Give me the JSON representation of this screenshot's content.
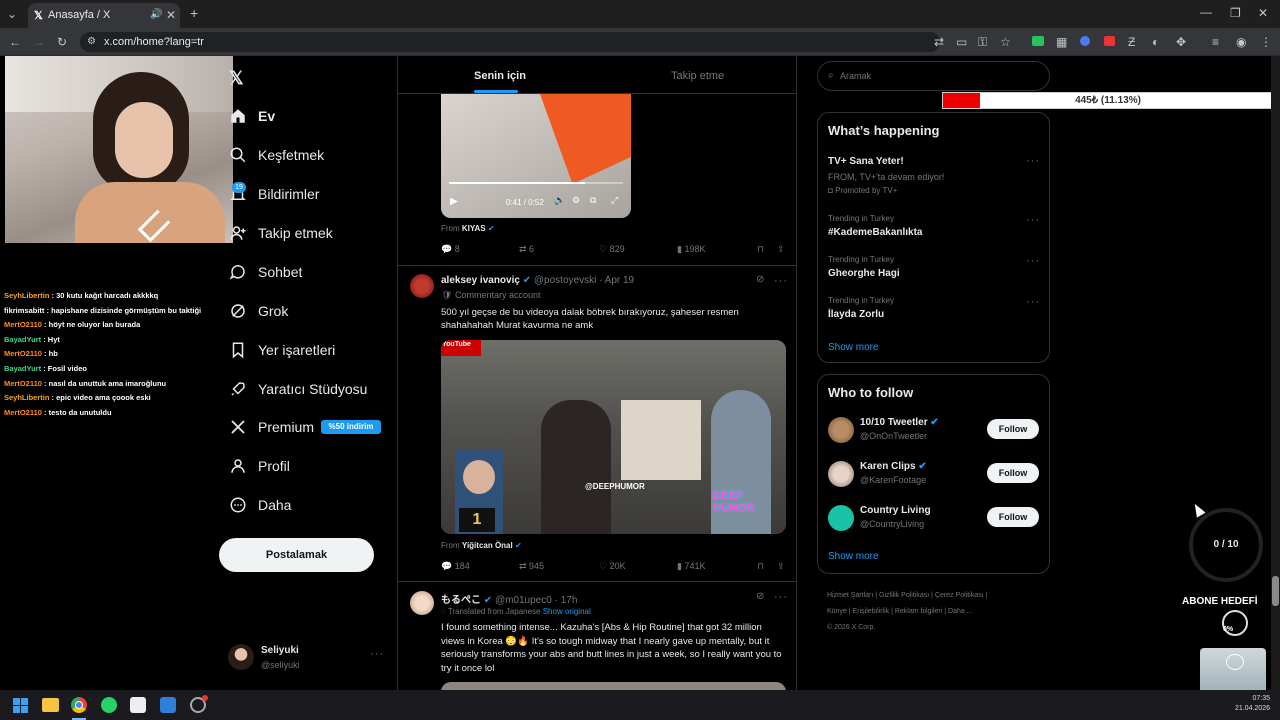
{
  "browser": {
    "tab_title": "Anasayfa / X",
    "url": "x.com/home?lang=tr"
  },
  "sidebar": {
    "items": [
      {
        "label": "Ev"
      },
      {
        "label": "Keşfetmek"
      },
      {
        "label": "Bildirimler",
        "badge": "19"
      },
      {
        "label": "Takip etmek"
      },
      {
        "label": "Sohbet"
      },
      {
        "label": "Grok"
      },
      {
        "label": "Yer işaretleri"
      },
      {
        "label": "Yaratıcı Stüdyosu"
      },
      {
        "label": "Premium",
        "badge": "%50 indirim"
      },
      {
        "label": "Profil"
      },
      {
        "label": "Daha"
      }
    ],
    "post_button": "Postalamak",
    "account": {
      "name": "Seliyuki",
      "handle": "@seliyuki"
    }
  },
  "feed": {
    "tabs": [
      "Senin için",
      "Takip etme"
    ],
    "video1": {
      "time": "0:41 / 0:52",
      "from_label": "From",
      "from_name": "KIYAS"
    },
    "actions1": {
      "replies": "8",
      "reposts": "6",
      "likes": "829",
      "views": "198K"
    },
    "tweet2": {
      "name": "aleksey ivanoviç",
      "handle": "@postoyevski",
      "date": "· Apr 19",
      "label": "Commentary account",
      "text": "500 yıl geçse de bu videoya dalak böbrek bırakıyoruz, şaheser resmen shahahahah Murat kavurma ne amk",
      "image_tag_top": "YouTube",
      "image_watermark": "@DEEPHUMOR",
      "image_number": "1",
      "image_brand": "DEEP HUMOR",
      "from_label": "From",
      "from_name": "Yiğitcan Önal"
    },
    "actions2": {
      "replies": "184",
      "reposts": "945",
      "likes": "20K",
      "views": "741K"
    },
    "tweet3": {
      "name": "もるぺこ",
      "handle": "@m01upec0",
      "date": "· 17h",
      "translated": "Translated from Japanese",
      "show_original": "Show original",
      "text": "I found something intense... Kazuha's [Abs & Hip Routine] that got 32 million views in Korea 😳🔥 It's so tough midway that I nearly gave up mentally, but it seriously transforms your abs and butt lines in just a week, so I really want you to try it once lol"
    }
  },
  "right": {
    "search_placeholder": "Aramak",
    "overlay_bar": "445₺ (11.13%)",
    "overlay_fill_fraction": 0.1113,
    "whats_happening": "What’s happening",
    "promo": {
      "title": "TV+ Sana Yeter!",
      "sub": "FROM, TV+'ta devam ediyor!",
      "promoted": "Promoted by TV+"
    },
    "trends": [
      {
        "context": "Trending in Turkey",
        "name": "#KademeBakanlıkta"
      },
      {
        "context": "Trending in Turkey",
        "name": "Gheorghe Hagi"
      },
      {
        "context": "Trending in Turkey",
        "name": "İlayda Zorlu"
      }
    ],
    "show_more": "Show more",
    "who_to_follow": "Who to follow",
    "follow": [
      {
        "name": "10/10 Tweetler",
        "handle": "@OnOnTweetler"
      },
      {
        "name": "Karen Clips",
        "handle": "@KarenFootage"
      },
      {
        "name": "Country Living",
        "handle": "@CountryLiving"
      }
    ],
    "follow_label": "Follow",
    "footer": [
      "Hizmet Şartları",
      "Gizlilik Politikası",
      "Çerez Politikası",
      "Künye",
      "Erişilebilirlik",
      "Reklam bilgileri",
      "Daha ...",
      "© 2026 X Corp."
    ]
  },
  "overlay": {
    "goal_counter": "0 / 10",
    "goal_label": "ABONE HEDEFİ",
    "goal_percent": "0%"
  },
  "chat": [
    {
      "user": "SeyhLibertin",
      "msg": "30 kutu kağıt harcadı akkkkq",
      "color": "#f5a623"
    },
    {
      "user": "fikrimsabitt",
      "msg": "hapishane dizisinde görmüştüm bu taktiği",
      "color": "#ffffff"
    },
    {
      "user": "MertO2110",
      "msg": "höyt ne oluyor lan burada",
      "color": "#ff8c1a"
    },
    {
      "user": "BayadYurt",
      "msg": "Hyt",
      "color": "#3dd68c"
    },
    {
      "user": "MertO2110",
      "msg": "hb",
      "color": "#ff8c1a"
    },
    {
      "user": "BayadYurt",
      "msg": "Fosil video",
      "color": "#3dd68c"
    },
    {
      "user": "MertO2110",
      "msg": "nasıl da unuttuk ama imaroğlunu",
      "color": "#ff8c1a"
    },
    {
      "user": "SeyhLibertin",
      "msg": "epic video ama çoook eski",
      "color": "#f5a623"
    },
    {
      "user": "MertO2110",
      "msg": "testo da unutuldu",
      "color": "#ff8c1a"
    }
  ],
  "taskbar": {
    "time": "07:35",
    "date": "21.04.2026"
  }
}
